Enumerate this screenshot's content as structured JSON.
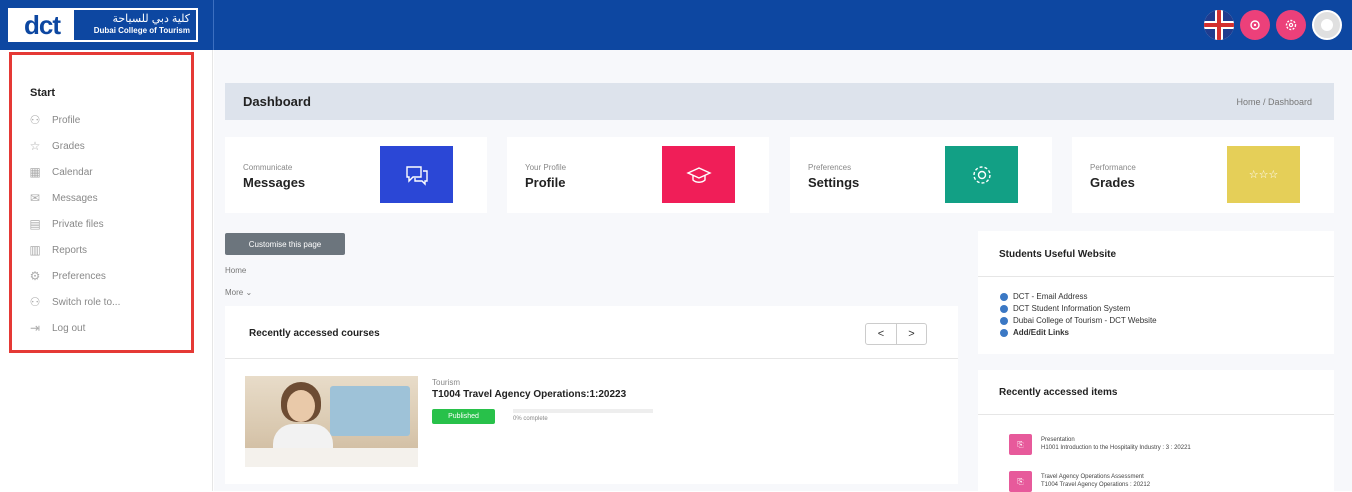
{
  "logo": {
    "short": "dct",
    "arabic": "كلية دبي للسياحة",
    "english": "Dubai College of Tourism"
  },
  "topbar": {
    "icons": [
      "uk-flag-icon",
      "notification-icon",
      "settings-icon",
      "user-avatar-icon"
    ]
  },
  "sidebar": {
    "start": "Start",
    "items": [
      {
        "label": "Profile",
        "icon": "profile-icon"
      },
      {
        "label": "Grades",
        "icon": "grades-icon"
      },
      {
        "label": "Calendar",
        "icon": "calendar-icon"
      },
      {
        "label": "Messages",
        "icon": "messages-icon"
      },
      {
        "label": "Private files",
        "icon": "file-icon"
      },
      {
        "label": "Reports",
        "icon": "reports-icon"
      },
      {
        "label": "Preferences",
        "icon": "gear-icon"
      },
      {
        "label": "Switch role to...",
        "icon": "users-icon"
      },
      {
        "label": "Log out",
        "icon": "logout-icon"
      }
    ]
  },
  "header": {
    "title": "Dashboard",
    "breadcrumb": "Home / Dashboard"
  },
  "cards": [
    {
      "sub": "Communicate",
      "main": "Messages",
      "color": "#2b47d6",
      "icon": "chat-bubbles-icon"
    },
    {
      "sub": "Your Profile",
      "main": "Profile",
      "color": "#f01e58",
      "icon": "graduation-cap-icon"
    },
    {
      "sub": "Preferences",
      "main": "Settings",
      "color": "#12a085",
      "icon": "gear-icon"
    },
    {
      "sub": "Performance",
      "main": "Grades",
      "color": "#e5cf58",
      "icon": "star-hand-icon"
    }
  ],
  "customise": "Customise this page",
  "links": {
    "home": "Home",
    "more": "More ⌄"
  },
  "courses": {
    "title": "Recently accessed courses",
    "prev": "<",
    "next": ">",
    "item": {
      "category": "Tourism",
      "name": "T1004 Travel Agency Operations:1:20223",
      "status": "Published",
      "progress_text": "0% complete",
      "progress": 0
    }
  },
  "useful": {
    "title": "Students Useful Website",
    "links": [
      "DCT - Email Address",
      "DCT Student Information System",
      "Dubai College of Tourism - DCT Website",
      "Add/Edit Links"
    ]
  },
  "recent_items": {
    "title": "Recently accessed items",
    "items": [
      {
        "type": "Presentation",
        "name": "H1001 Introduction to the Hospitality Industry : 3 : 20221"
      },
      {
        "type": "Travel Agency Operations Assessment",
        "name": "T1004 Travel Agency Operations : 20212"
      }
    ]
  },
  "colors": {
    "topbar": "#0d47a1",
    "highlight": "#e53935",
    "published": "#28c14a"
  }
}
